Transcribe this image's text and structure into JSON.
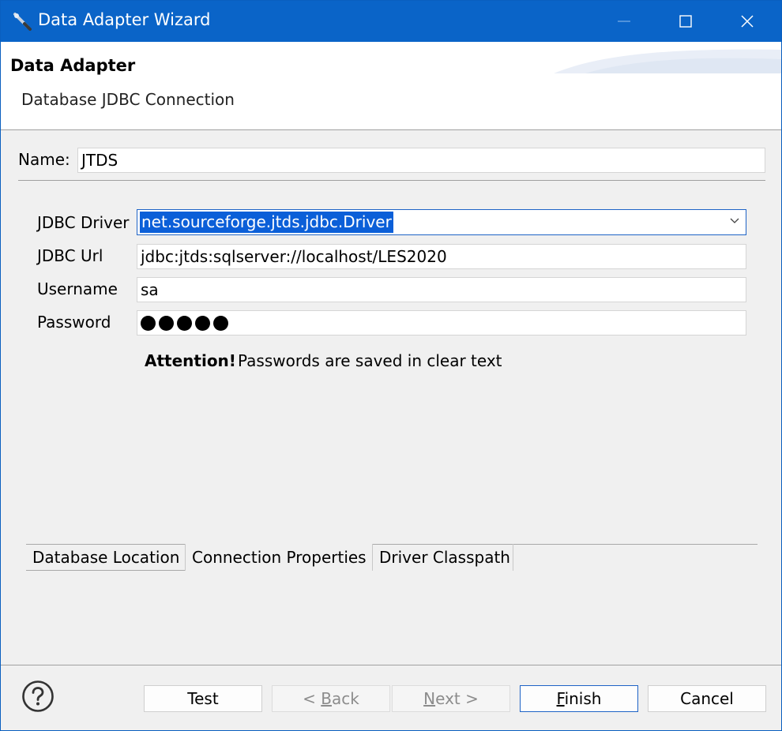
{
  "window": {
    "title": "Data Adapter Wizard"
  },
  "header": {
    "title": "Data Adapter",
    "subtitle": "Database JDBC Connection"
  },
  "name_field": {
    "label": "Name:",
    "value": "JTDS"
  },
  "form": {
    "driver_label": "JDBC Driver",
    "driver_value": "net.sourceforge.jtds.jdbc.Driver",
    "url_label": "JDBC Url",
    "url_value": "jdbc:jtds:sqlserver://localhost/LES2020",
    "username_label": "Username",
    "username_value": "sa",
    "password_label": "Password",
    "password_length": 5
  },
  "attention": {
    "bold": "Attention!",
    "text": "Passwords are saved in clear text"
  },
  "tabs": [
    {
      "label": "Database Location"
    },
    {
      "label": "Connection Properties"
    },
    {
      "label": "Driver Classpath"
    }
  ],
  "buttons": {
    "test": "Test",
    "back": {
      "prefix": "< ",
      "mnemonic": "B",
      "rest": "ack"
    },
    "next": {
      "mnemonic": "N",
      "rest": "ext >"
    },
    "finish": {
      "mnemonic": "F",
      "rest": "inish"
    },
    "cancel": "Cancel"
  },
  "icons": {
    "app": "data-adapter-icon",
    "minimize": "minimize-icon",
    "maximize": "maximize-icon",
    "close": "close-icon",
    "dropdown": "chevron-down-icon",
    "help": "help-icon"
  },
  "colors": {
    "titlebar": "#0a64c8",
    "selection": "#0b5fd8",
    "focus_border": "#1e63c6"
  }
}
